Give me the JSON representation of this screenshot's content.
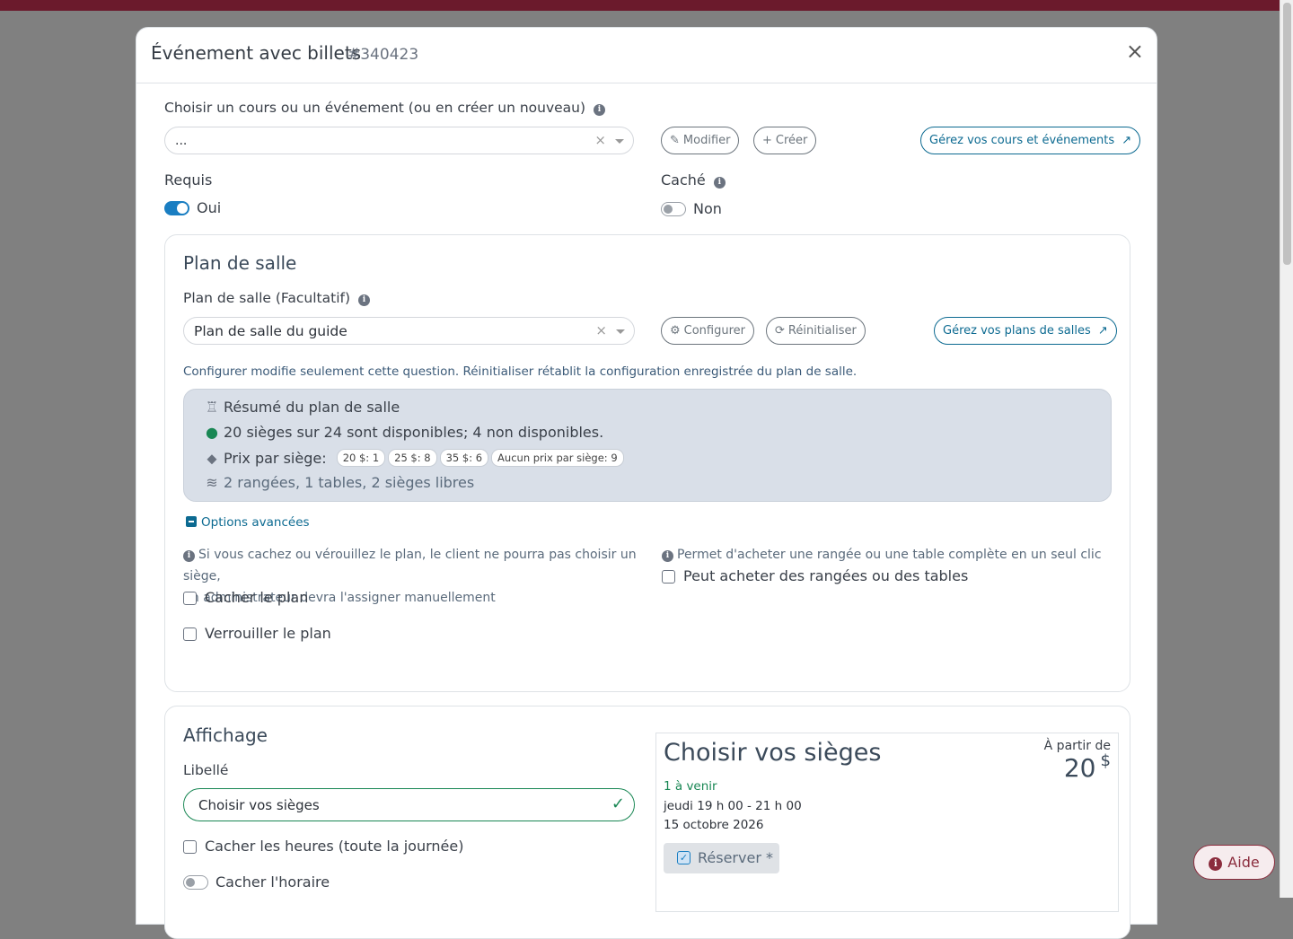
{
  "modal": {
    "title": "Événement avec billets",
    "event_id": "#340423",
    "close_label": "×"
  },
  "event_select": {
    "label": "Choisir un cours ou un événement (ou en créer un nouveau)",
    "value": "...",
    "modify_label": "Modifier",
    "create_label": "Créer",
    "manage_label": "Gérez vos cours et événements"
  },
  "required": {
    "label": "Requis",
    "value": "Oui",
    "on": true
  },
  "hidden": {
    "label": "Caché",
    "value": "Non",
    "on": false
  },
  "seating": {
    "title": "Plan de salle",
    "field_label": "Plan de salle (Facultatif)",
    "value": "Plan de salle du guide",
    "configure_label": "Configurer",
    "reset_label": "Réinitialiser",
    "manage_label": "Gérez vos plans de salles",
    "help_text": "Configurer modifie seulement cette question. Réinitialiser rétablit la configuration enregistrée du plan de salle.",
    "summary": {
      "title": "Résumé du plan de salle",
      "availability": "20 sièges sur 24 sont disponibles; 4 non disponibles.",
      "price_label": "Prix par siège:",
      "prices": [
        "20 $: 1",
        "25 $: 8",
        "35 $: 6",
        "Aucun prix par siège: 9"
      ],
      "layout": "2 rangées, 1 tables, 2 sièges libres"
    },
    "advanced_label": "Options avancées",
    "hide_info_line1": "Si vous cachez ou vérouillez le plan, le client ne pourra pas choisir un siège,",
    "hide_info_line2": "un administrateur devra l'assigner manuellement",
    "hide_plan_label": "Cacher le plan",
    "lock_plan_label": "Verrouiller le plan",
    "rows_info": "Permet d'acheter une rangée ou une table complète en un seul clic",
    "rows_label": "Peut acheter des rangées ou des tables"
  },
  "display": {
    "title": "Affichage",
    "label_field_label": "Libellé",
    "label_value": "Choisir vos sièges",
    "hide_hours_label": "Cacher les heures (toute la journée)",
    "hide_schedule_label": "Cacher l'horaire"
  },
  "preview": {
    "title": "Choisir vos sièges",
    "from_label": "À partir de",
    "price": "20",
    "currency": "$",
    "upcoming": "1 à venir",
    "time": "jeudi 19 h 00 - 21 h 00",
    "date": "15 octobre 2026",
    "reserve_label": "Réserver *"
  },
  "help_button": {
    "label": "Aide"
  },
  "colors": {
    "primary": "#0c6a91",
    "toggle_on": "#1a7ec2",
    "success": "#198754",
    "brand": "#8b2c3d",
    "summary_bg": "#d9dfe8"
  }
}
